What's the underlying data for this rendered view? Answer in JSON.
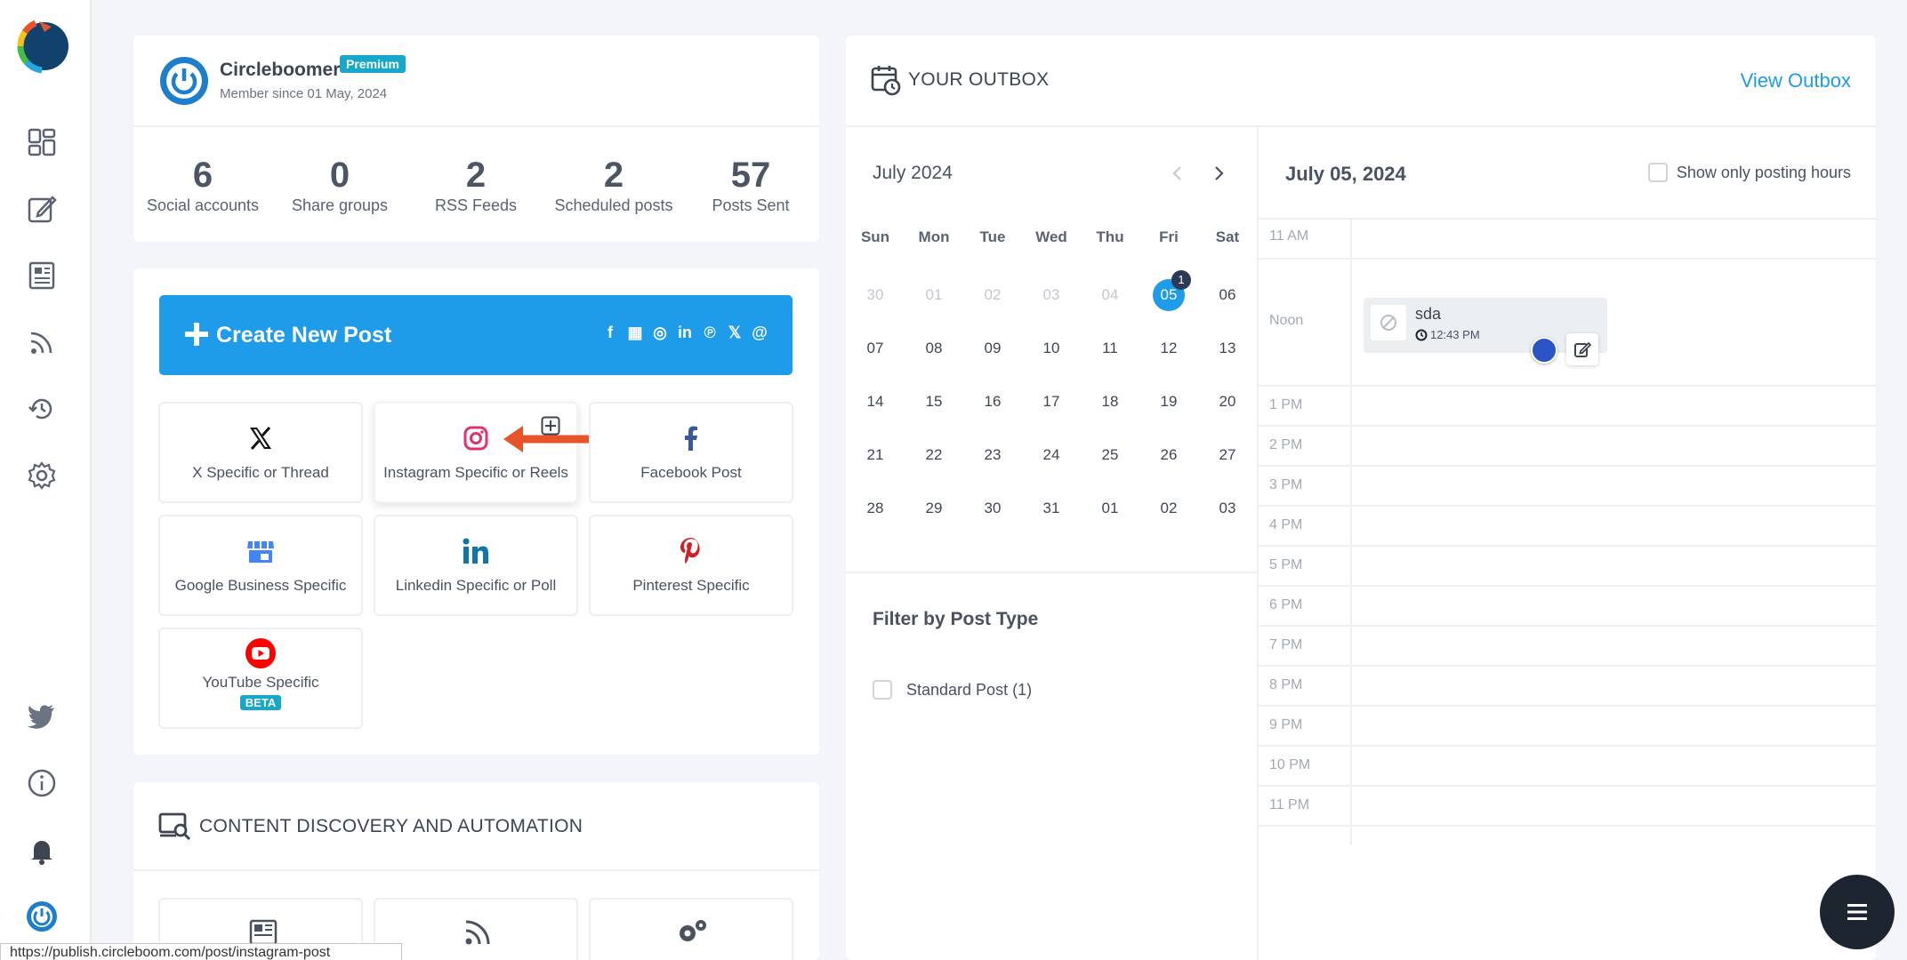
{
  "profile": {
    "name": "Circleboomer",
    "badge": "Premium",
    "member_since": "Member since 01 May, 2024"
  },
  "stats": [
    {
      "value": "6",
      "label": "Social accounts"
    },
    {
      "value": "0",
      "label": "Share groups"
    },
    {
      "value": "2",
      "label": "RSS Feeds"
    },
    {
      "value": "2",
      "label": "Scheduled posts"
    },
    {
      "value": "57",
      "label": "Posts Sent"
    }
  ],
  "create": {
    "label": "Create New Post",
    "social_glyphs": [
      "f",
      "▦",
      "◎",
      "in",
      "℗",
      "𝕏",
      "@"
    ]
  },
  "tiles": [
    {
      "label": "X Specific or Thread",
      "icon": "x-logo-icon"
    },
    {
      "label": "Instagram Specific or Reels",
      "icon": "instagram-icon"
    },
    {
      "label": "Facebook Post",
      "icon": "facebook-icon"
    },
    {
      "label": "Google Business Specific",
      "icon": "google-business-icon"
    },
    {
      "label": "Linkedin Specific or Poll",
      "icon": "linkedin-icon"
    },
    {
      "label": "Pinterest Specific",
      "icon": "pinterest-icon"
    },
    {
      "label": "YouTube Specific",
      "icon": "youtube-icon",
      "badge": "BETA"
    }
  ],
  "discovery": {
    "title": "CONTENT DISCOVERY AND AUTOMATION"
  },
  "outbox": {
    "title": "YOUR OUTBOX",
    "view_link": "View Outbox"
  },
  "calendar": {
    "month": "July 2024",
    "weekdays": [
      "Sun",
      "Mon",
      "Tue",
      "Wed",
      "Thu",
      "Fri",
      "Sat"
    ],
    "weeks": [
      [
        "30",
        "01",
        "02",
        "03",
        "04",
        "05",
        "06"
      ],
      [
        "07",
        "08",
        "09",
        "10",
        "11",
        "12",
        "13"
      ],
      [
        "14",
        "15",
        "16",
        "17",
        "18",
        "19",
        "20"
      ],
      [
        "21",
        "22",
        "23",
        "24",
        "25",
        "26",
        "27"
      ],
      [
        "28",
        "29",
        "30",
        "31",
        "01",
        "02",
        "03"
      ]
    ],
    "selected_day": "05",
    "selected_badge": "1"
  },
  "filter": {
    "title": "Filter by Post Type",
    "option": "Standard Post (1)"
  },
  "day_view": {
    "date": "July 05, 2024",
    "toggle_label": "Show only posting hours",
    "hours": [
      "11 AM",
      "Noon",
      "1 PM",
      "2 PM",
      "3 PM",
      "4 PM",
      "5 PM",
      "6 PM",
      "7 PM",
      "8 PM",
      "9 PM",
      "10 PM",
      "11 PM"
    ],
    "event": {
      "title": "sda",
      "time": "12:43 PM"
    }
  },
  "status_url": "https://publish.circleboom.com/post/instagram-post",
  "colors": {
    "accent": "#1e9be9",
    "badge": "#17a7c9",
    "arrow": "#e8542a"
  }
}
